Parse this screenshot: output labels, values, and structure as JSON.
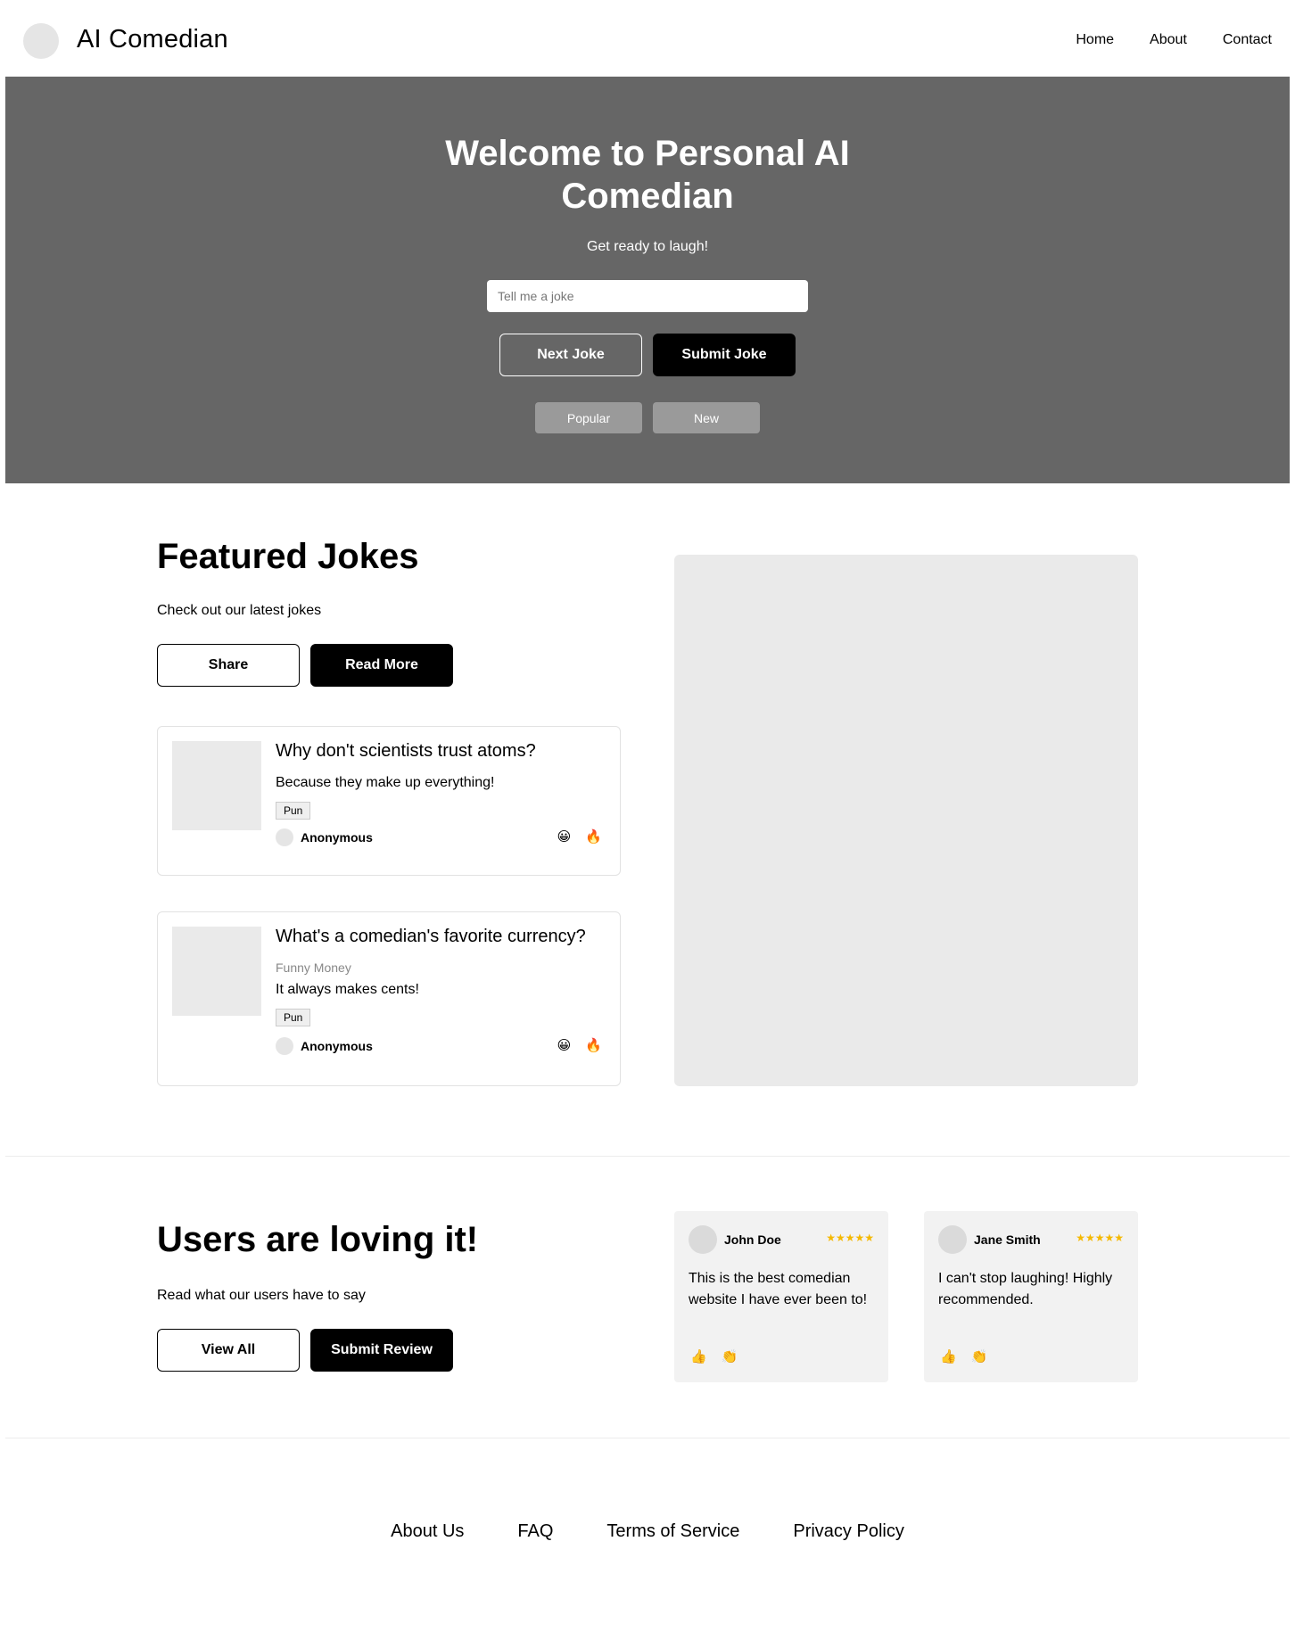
{
  "header": {
    "brand": "AI Comedian",
    "nav": [
      "Home",
      "About",
      "Contact"
    ]
  },
  "hero": {
    "title": "Welcome to Personal AI Comedian",
    "subtitle": "Get ready to laugh!",
    "input_placeholder": "Tell me a joke",
    "next_label": "Next Joke",
    "submit_label": "Submit Joke",
    "filters": [
      "Popular",
      "New"
    ]
  },
  "featured": {
    "title": "Featured Jokes",
    "subtitle": "Check out our latest jokes",
    "share_label": "Share",
    "readmore_label": "Read More",
    "jokes": [
      {
        "question": "Why don't scientists trust atoms?",
        "answer": "Because they make up everything!",
        "tag": "Pun",
        "author": "Anonymous",
        "reactions": [
          "😀",
          "🔥"
        ]
      },
      {
        "question": "What's a comedian's favorite currency?",
        "meta": "Funny Money",
        "answer": "It always makes cents!",
        "tag": "Pun",
        "author": "Anonymous",
        "reactions": [
          "😀",
          "🔥"
        ]
      }
    ]
  },
  "testimonials": {
    "title": "Users are loving it!",
    "subtitle": "Read what our users have to say",
    "viewall_label": "View All",
    "submit_label": "Submit Review",
    "reviews": [
      {
        "name": "John Doe",
        "stars": "★★★★★",
        "rating": 5,
        "text": "This is the best comedian website I have ever been to!",
        "actions": [
          "👍",
          "👏"
        ]
      },
      {
        "name": "Jane Smith",
        "stars": "★★★★★",
        "rating": 5,
        "text": "I can't stop laughing! Highly recommended.",
        "actions": [
          "👍",
          "👏"
        ]
      }
    ]
  },
  "footer": {
    "links": [
      "About Us",
      "FAQ",
      "Terms of Service",
      "Privacy Policy"
    ]
  },
  "colors": {
    "hero_bg": "#666666",
    "star": "#f5b800",
    "placeholder_bg": "#eaeaea",
    "review_bg": "#f2f2f2"
  }
}
